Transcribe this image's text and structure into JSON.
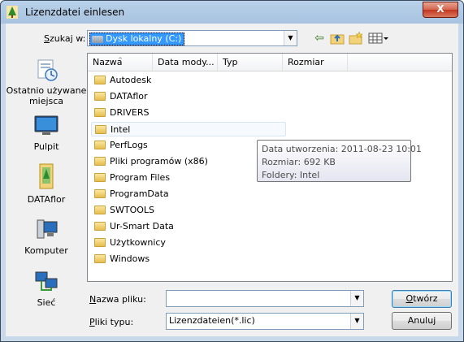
{
  "window": {
    "title": "Lizenzdatei einlesen",
    "close_label": "X"
  },
  "lookin": {
    "label": "Szukaj w:",
    "value": "Dysk lokalny (C:)"
  },
  "toolbar": {
    "back_glyph": "⇦",
    "up_glyph": "⬑",
    "new_folder_glyph": "✱",
    "views_glyph": "▦▾"
  },
  "places": [
    {
      "label": "Ostatnio używane miejsca",
      "icon": "recent-places-icon"
    },
    {
      "label": "Pulpit",
      "icon": "desktop-icon"
    },
    {
      "label": "DATAflor",
      "icon": "dataflor-folder-icon"
    },
    {
      "label": "Komputer",
      "icon": "computer-icon"
    },
    {
      "label": "Sieć",
      "icon": "network-icon"
    }
  ],
  "columns": [
    "Nazwa",
    "Data mody...",
    "Typ",
    "Rozmiar"
  ],
  "sort_indicator": "^",
  "files": [
    "Autodesk",
    "DATAflor",
    "DRIVERS",
    "Intel",
    "PerfLogs",
    "Pliki programów (x86)",
    "Program Files",
    "ProgramData",
    "SWTOOLS",
    "Ur-Smart Data",
    "Użytkownicy",
    "Windows"
  ],
  "tooltip": {
    "line1": "Data utworzenia: 2011-08-23 10:01",
    "line2": "Rozmiar: 692 KB",
    "line3": "Foldery: Intel"
  },
  "filename": {
    "label_prefix": "N",
    "label_rest": "azwa pliku:",
    "value": ""
  },
  "filetype": {
    "label_prefix": "P",
    "label_rest": "liki typu:",
    "value": "Lizenzdateien(*.lic)"
  },
  "buttons": {
    "open_prefix": "O",
    "open_rest": "twórz",
    "cancel": "Anuluj"
  },
  "colors": {
    "selection": "#3399ff",
    "folder": "#e6be4e",
    "titlebar": "#b9d1ea",
    "close": "#c3361f"
  }
}
